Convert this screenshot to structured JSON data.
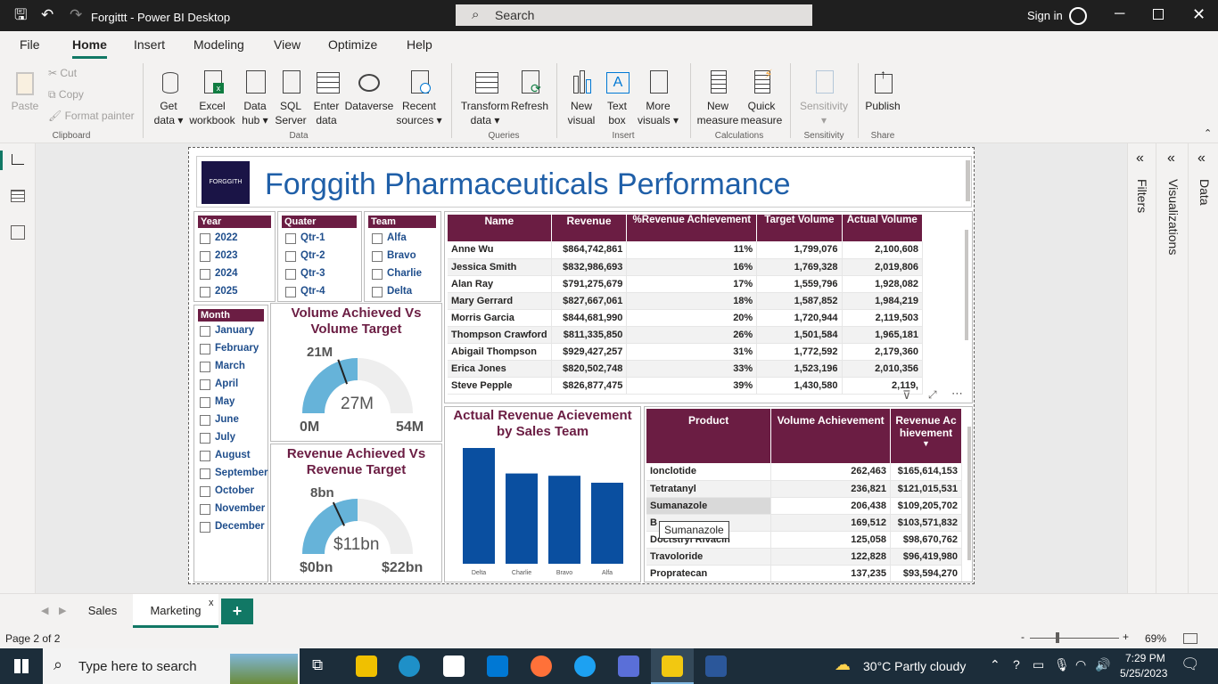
{
  "window": {
    "title": "Forgittt - Power BI Desktop",
    "search_placeholder": "Search",
    "sign_in": "Sign in"
  },
  "menu": [
    "File",
    "Home",
    "Insert",
    "Modeling",
    "View",
    "Optimize",
    "Help"
  ],
  "ribbon": {
    "clipboard": {
      "paste": "Paste",
      "cut": "Cut",
      "copy": "Copy",
      "format_painter": "Format painter",
      "group": "Clipboard"
    },
    "data": [
      {
        "l1": "Get",
        "l2": "data ▾"
      },
      {
        "l1": "Excel",
        "l2": "workbook"
      },
      {
        "l1": "Data",
        "l2": "hub ▾"
      },
      {
        "l1": "SQL",
        "l2": "Server"
      },
      {
        "l1": "Enter",
        "l2": "data"
      },
      {
        "l1": "Dataverse",
        "l2": ""
      },
      {
        "l1": "Recent",
        "l2": "sources ▾"
      }
    ],
    "data_group": "Data",
    "queries": [
      {
        "l1": "Transform",
        "l2": "data ▾"
      },
      {
        "l1": "Refresh",
        "l2": ""
      }
    ],
    "queries_group": "Queries",
    "insert": [
      {
        "l1": "New",
        "l2": "visual"
      },
      {
        "l1": "Text",
        "l2": "box"
      },
      {
        "l1": "More",
        "l2": "visuals ▾"
      }
    ],
    "insert_group": "Insert",
    "calculations": [
      {
        "l1": "New",
        "l2": "measure"
      },
      {
        "l1": "Quick",
        "l2": "measure"
      }
    ],
    "calculations_group": "Calculations",
    "sensitivity": {
      "l1": "Sensitivity",
      "l2": "▾"
    },
    "sensitivity_group": "Sensitivity",
    "publish": {
      "l1": "Publish"
    },
    "share_group": "Share"
  },
  "report": {
    "logo_text": "FORGGITH",
    "title": "Forggith Pharmaceuticals Performance",
    "slicers": {
      "year": {
        "header": "Year",
        "items": [
          "2022",
          "2023",
          "2024",
          "2025"
        ]
      },
      "quarter": {
        "header": "Quater",
        "items": [
          "Qtr-1",
          "Qtr-2",
          "Qtr-3",
          "Qtr-4"
        ]
      },
      "team": {
        "header": "Team",
        "items": [
          "Alfa",
          "Bravo",
          "Charlie",
          "Delta"
        ]
      },
      "month": {
        "header": "Month",
        "items": [
          "January",
          "February",
          "March",
          "April",
          "May",
          "June",
          "July",
          "August",
          "September",
          "October",
          "November",
          "December"
        ]
      }
    },
    "gauge_volume": {
      "title1": "Volume Achieved Vs",
      "title2": "Volume Target",
      "target": "21M",
      "value": "27M",
      "min": "0M",
      "max": "54M",
      "fraction": 0.5
    },
    "gauge_revenue": {
      "title1": "Revenue Achieved Vs",
      "title2": "Revenue Target",
      "target": "8bn",
      "value": "$11bn",
      "min": "$0bn",
      "max": "$22bn",
      "fraction": 0.5
    },
    "sales_table": {
      "headers": [
        "Name",
        "Revenue",
        "%Revenue Achievement",
        "Target Volume",
        "Actual Volume"
      ],
      "rows": [
        [
          "Anne Wu",
          "$864,742,861",
          "11%",
          "1,799,076",
          "2,100,608"
        ],
        [
          "Jessica Smith",
          "$832,986,693",
          "16%",
          "1,769,328",
          "2,019,806"
        ],
        [
          "Alan Ray",
          "$791,275,679",
          "17%",
          "1,559,796",
          "1,928,082"
        ],
        [
          "Mary Gerrard",
          "$827,667,061",
          "18%",
          "1,587,852",
          "1,984,219"
        ],
        [
          "Morris Garcia",
          "$844,681,990",
          "20%",
          "1,720,944",
          "2,119,503"
        ],
        [
          "Thompson Crawford",
          "$811,335,850",
          "26%",
          "1,501,584",
          "1,965,181"
        ],
        [
          "Abigail Thompson",
          "$929,427,257",
          "31%",
          "1,772,592",
          "2,179,360"
        ],
        [
          "Erica Jones",
          "$820,502,748",
          "33%",
          "1,523,196",
          "2,010,356"
        ],
        [
          "Steve Pepple",
          "$826,877,475",
          "39%",
          "1,430,580",
          "2,119,"
        ]
      ]
    },
    "bar_chart": {
      "title1": "Actual Revenue Acievement",
      "title2": "by Sales Team"
    },
    "product_table": {
      "headers": [
        "Product",
        "Volume Achievement",
        "Revenue Achievement"
      ],
      "rows": [
        [
          "Ionclotide",
          "262,463",
          "$165,614,153"
        ],
        [
          "Tetratanyl",
          "236,821",
          "$121,015,531"
        ],
        [
          "Sumanazole",
          "206,438",
          "$109,205,702"
        ],
        [
          "B",
          "169,512",
          "$103,571,832"
        ],
        [
          "Doctstryl Rivacin",
          "125,058",
          "$98,670,762"
        ],
        [
          "Travoloride",
          "122,828",
          "$96,419,980"
        ],
        [
          "Propratecan",
          "137,235",
          "$93,594,270"
        ]
      ],
      "tooltip": "Sumanazole"
    }
  },
  "chart_data": {
    "type": "bar",
    "categories": [
      "Delta",
      "Charlie",
      "Bravo",
      "Alfa"
    ],
    "values": [
      100,
      78,
      76,
      70
    ],
    "title": "Actual Revenue Acievement by Sales Team",
    "xlabel": "",
    "ylabel": ""
  },
  "panes": {
    "filters": "Filters",
    "visualizations": "Visualizations",
    "data": "Data"
  },
  "tabs": {
    "items": [
      "Sales",
      "Marketing"
    ],
    "active": "Marketing",
    "close": "x",
    "add": "+"
  },
  "status": {
    "page": "Page 2 of 2",
    "zoom": "69%"
  },
  "taskbar": {
    "search": "Type here to search",
    "weather": "30°C  Partly cloudy",
    "time": "7:29 PM",
    "date": "5/25/2023"
  },
  "colors": {
    "maroon": "#6b1d43",
    "blue": "#0a4fa0",
    "gauge": "#66b3d9",
    "title_blue": "#1f4e8c"
  }
}
